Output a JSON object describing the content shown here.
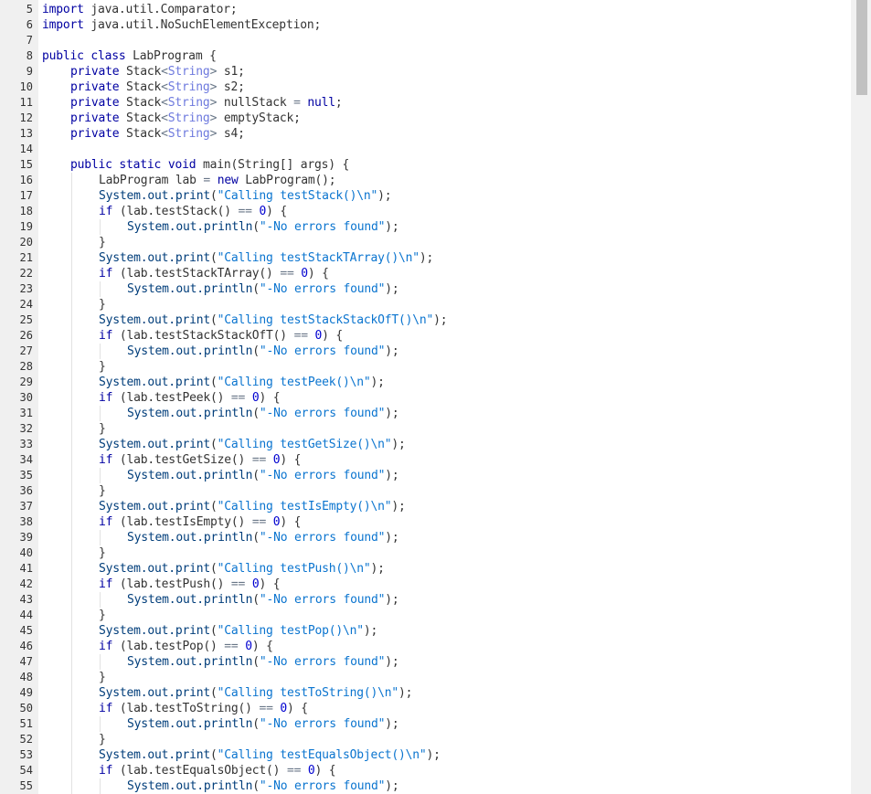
{
  "editor": {
    "lines": [
      {
        "n": "5",
        "indent": 0,
        "tokens": [
          [
            "k",
            "import"
          ],
          [
            "p",
            " java.util.Comparator;"
          ]
        ]
      },
      {
        "n": "6",
        "indent": 0,
        "tokens": [
          [
            "k",
            "import"
          ],
          [
            "p",
            " java.util.NoSuchElementException;"
          ]
        ]
      },
      {
        "n": "7",
        "indent": 0,
        "tokens": []
      },
      {
        "n": "8",
        "indent": 0,
        "tokens": [
          [
            "k",
            "public"
          ],
          [
            "p",
            " "
          ],
          [
            "k",
            "class"
          ],
          [
            "p",
            " LabProgram {"
          ]
        ]
      },
      {
        "n": "9",
        "indent": 1,
        "tokens": [
          [
            "k",
            "private"
          ],
          [
            "p",
            " Stack"
          ],
          [
            "o",
            "<"
          ],
          [
            "t",
            "String"
          ],
          [
            "o",
            ">"
          ],
          [
            "p",
            " s1;"
          ]
        ]
      },
      {
        "n": "10",
        "indent": 1,
        "tokens": [
          [
            "k",
            "private"
          ],
          [
            "p",
            " Stack"
          ],
          [
            "o",
            "<"
          ],
          [
            "t",
            "String"
          ],
          [
            "o",
            ">"
          ],
          [
            "p",
            " s2;"
          ]
        ]
      },
      {
        "n": "11",
        "indent": 1,
        "tokens": [
          [
            "k",
            "private"
          ],
          [
            "p",
            " Stack"
          ],
          [
            "o",
            "<"
          ],
          [
            "t",
            "String"
          ],
          [
            "o",
            ">"
          ],
          [
            "p",
            " nullStack "
          ],
          [
            "o",
            "="
          ],
          [
            "p",
            " "
          ],
          [
            "k",
            "null"
          ],
          [
            "p",
            ";"
          ]
        ]
      },
      {
        "n": "12",
        "indent": 1,
        "tokens": [
          [
            "k",
            "private"
          ],
          [
            "p",
            " Stack"
          ],
          [
            "o",
            "<"
          ],
          [
            "t",
            "String"
          ],
          [
            "o",
            ">"
          ],
          [
            "p",
            " emptyStack;"
          ]
        ]
      },
      {
        "n": "13",
        "indent": 1,
        "tokens": [
          [
            "k",
            "private"
          ],
          [
            "p",
            " Stack"
          ],
          [
            "o",
            "<"
          ],
          [
            "t",
            "String"
          ],
          [
            "o",
            ">"
          ],
          [
            "p",
            " s4;"
          ]
        ]
      },
      {
        "n": "14",
        "indent": 0,
        "tokens": []
      },
      {
        "n": "15",
        "indent": 1,
        "tokens": [
          [
            "k",
            "public"
          ],
          [
            "p",
            " "
          ],
          [
            "k",
            "static"
          ],
          [
            "p",
            " "
          ],
          [
            "k",
            "void"
          ],
          [
            "p",
            " main(String[] args) {"
          ]
        ]
      },
      {
        "n": "16",
        "indent": 2,
        "tokens": [
          [
            "p",
            "LabProgram lab "
          ],
          [
            "o",
            "="
          ],
          [
            "p",
            " "
          ],
          [
            "k",
            "new"
          ],
          [
            "p",
            " LabProgram();"
          ]
        ]
      },
      {
        "n": "17",
        "indent": 2,
        "tokens": [
          [
            "c",
            "System.out.print"
          ],
          [
            "p",
            "("
          ],
          [
            "s",
            "\"Calling testStack()\\n\""
          ],
          [
            "p",
            ");"
          ]
        ]
      },
      {
        "n": "18",
        "indent": 2,
        "tokens": [
          [
            "k",
            "if"
          ],
          [
            "p",
            " (lab.testStack() "
          ],
          [
            "o",
            "=="
          ],
          [
            "p",
            " "
          ],
          [
            "n",
            "0"
          ],
          [
            "p",
            ") {"
          ]
        ]
      },
      {
        "n": "19",
        "indent": 3,
        "tokens": [
          [
            "c",
            "System.out.println"
          ],
          [
            "p",
            "("
          ],
          [
            "s",
            "\"-No errors found\""
          ],
          [
            "p",
            ");"
          ]
        ]
      },
      {
        "n": "20",
        "indent": 2,
        "tokens": [
          [
            "p",
            "}"
          ]
        ]
      },
      {
        "n": "21",
        "indent": 2,
        "tokens": [
          [
            "c",
            "System.out.print"
          ],
          [
            "p",
            "("
          ],
          [
            "s",
            "\"Calling testStackTArray()\\n\""
          ],
          [
            "p",
            ");"
          ]
        ]
      },
      {
        "n": "22",
        "indent": 2,
        "tokens": [
          [
            "k",
            "if"
          ],
          [
            "p",
            " (lab.testStackTArray() "
          ],
          [
            "o",
            "=="
          ],
          [
            "p",
            " "
          ],
          [
            "n",
            "0"
          ],
          [
            "p",
            ") {"
          ]
        ]
      },
      {
        "n": "23",
        "indent": 3,
        "tokens": [
          [
            "c",
            "System.out.println"
          ],
          [
            "p",
            "("
          ],
          [
            "s",
            "\"-No errors found\""
          ],
          [
            "p",
            ");"
          ]
        ]
      },
      {
        "n": "24",
        "indent": 2,
        "tokens": [
          [
            "p",
            "}"
          ]
        ]
      },
      {
        "n": "25",
        "indent": 2,
        "tokens": [
          [
            "c",
            "System.out.print"
          ],
          [
            "p",
            "("
          ],
          [
            "s",
            "\"Calling testStackStackOfT()\\n\""
          ],
          [
            "p",
            ");"
          ]
        ]
      },
      {
        "n": "26",
        "indent": 2,
        "tokens": [
          [
            "k",
            "if"
          ],
          [
            "p",
            " (lab.testStackStackOfT() "
          ],
          [
            "o",
            "=="
          ],
          [
            "p",
            " "
          ],
          [
            "n",
            "0"
          ],
          [
            "p",
            ") {"
          ]
        ]
      },
      {
        "n": "27",
        "indent": 3,
        "tokens": [
          [
            "c",
            "System.out.println"
          ],
          [
            "p",
            "("
          ],
          [
            "s",
            "\"-No errors found\""
          ],
          [
            "p",
            ");"
          ]
        ]
      },
      {
        "n": "28",
        "indent": 2,
        "tokens": [
          [
            "p",
            "}"
          ]
        ]
      },
      {
        "n": "29",
        "indent": 2,
        "tokens": [
          [
            "c",
            "System.out.print"
          ],
          [
            "p",
            "("
          ],
          [
            "s",
            "\"Calling testPeek()\\n\""
          ],
          [
            "p",
            ");"
          ]
        ]
      },
      {
        "n": "30",
        "indent": 2,
        "tokens": [
          [
            "k",
            "if"
          ],
          [
            "p",
            " (lab.testPeek() "
          ],
          [
            "o",
            "=="
          ],
          [
            "p",
            " "
          ],
          [
            "n",
            "0"
          ],
          [
            "p",
            ") {"
          ]
        ]
      },
      {
        "n": "31",
        "indent": 3,
        "tokens": [
          [
            "c",
            "System.out.println"
          ],
          [
            "p",
            "("
          ],
          [
            "s",
            "\"-No errors found\""
          ],
          [
            "p",
            ");"
          ]
        ]
      },
      {
        "n": "32",
        "indent": 2,
        "tokens": [
          [
            "p",
            "}"
          ]
        ]
      },
      {
        "n": "33",
        "indent": 2,
        "tokens": [
          [
            "c",
            "System.out.print"
          ],
          [
            "p",
            "("
          ],
          [
            "s",
            "\"Calling testGetSize()\\n\""
          ],
          [
            "p",
            ");"
          ]
        ]
      },
      {
        "n": "34",
        "indent": 2,
        "tokens": [
          [
            "k",
            "if"
          ],
          [
            "p",
            " (lab.testGetSize() "
          ],
          [
            "o",
            "=="
          ],
          [
            "p",
            " "
          ],
          [
            "n",
            "0"
          ],
          [
            "p",
            ") {"
          ]
        ]
      },
      {
        "n": "35",
        "indent": 3,
        "tokens": [
          [
            "c",
            "System.out.println"
          ],
          [
            "p",
            "("
          ],
          [
            "s",
            "\"-No errors found\""
          ],
          [
            "p",
            ");"
          ]
        ]
      },
      {
        "n": "36",
        "indent": 2,
        "tokens": [
          [
            "p",
            "}"
          ]
        ]
      },
      {
        "n": "37",
        "indent": 2,
        "tokens": [
          [
            "c",
            "System.out.print"
          ],
          [
            "p",
            "("
          ],
          [
            "s",
            "\"Calling testIsEmpty()\\n\""
          ],
          [
            "p",
            ");"
          ]
        ]
      },
      {
        "n": "38",
        "indent": 2,
        "tokens": [
          [
            "k",
            "if"
          ],
          [
            "p",
            " (lab.testIsEmpty() "
          ],
          [
            "o",
            "=="
          ],
          [
            "p",
            " "
          ],
          [
            "n",
            "0"
          ],
          [
            "p",
            ") {"
          ]
        ]
      },
      {
        "n": "39",
        "indent": 3,
        "tokens": [
          [
            "c",
            "System.out.println"
          ],
          [
            "p",
            "("
          ],
          [
            "s",
            "\"-No errors found\""
          ],
          [
            "p",
            ");"
          ]
        ]
      },
      {
        "n": "40",
        "indent": 2,
        "tokens": [
          [
            "p",
            "}"
          ]
        ]
      },
      {
        "n": "41",
        "indent": 2,
        "tokens": [
          [
            "c",
            "System.out.print"
          ],
          [
            "p",
            "("
          ],
          [
            "s",
            "\"Calling testPush()\\n\""
          ],
          [
            "p",
            ");"
          ]
        ]
      },
      {
        "n": "42",
        "indent": 2,
        "tokens": [
          [
            "k",
            "if"
          ],
          [
            "p",
            " (lab.testPush() "
          ],
          [
            "o",
            "=="
          ],
          [
            "p",
            " "
          ],
          [
            "n",
            "0"
          ],
          [
            "p",
            ") {"
          ]
        ]
      },
      {
        "n": "43",
        "indent": 3,
        "tokens": [
          [
            "c",
            "System.out.println"
          ],
          [
            "p",
            "("
          ],
          [
            "s",
            "\"-No errors found\""
          ],
          [
            "p",
            ");"
          ]
        ]
      },
      {
        "n": "44",
        "indent": 2,
        "tokens": [
          [
            "p",
            "}"
          ]
        ]
      },
      {
        "n": "45",
        "indent": 2,
        "tokens": [
          [
            "c",
            "System.out.print"
          ],
          [
            "p",
            "("
          ],
          [
            "s",
            "\"Calling testPop()\\n\""
          ],
          [
            "p",
            ");"
          ]
        ]
      },
      {
        "n": "46",
        "indent": 2,
        "tokens": [
          [
            "k",
            "if"
          ],
          [
            "p",
            " (lab.testPop() "
          ],
          [
            "o",
            "=="
          ],
          [
            "p",
            " "
          ],
          [
            "n",
            "0"
          ],
          [
            "p",
            ") {"
          ]
        ]
      },
      {
        "n": "47",
        "indent": 3,
        "tokens": [
          [
            "c",
            "System.out.println"
          ],
          [
            "p",
            "("
          ],
          [
            "s",
            "\"-No errors found\""
          ],
          [
            "p",
            ");"
          ]
        ]
      },
      {
        "n": "48",
        "indent": 2,
        "tokens": [
          [
            "p",
            "}"
          ]
        ]
      },
      {
        "n": "49",
        "indent": 2,
        "tokens": [
          [
            "c",
            "System.out.print"
          ],
          [
            "p",
            "("
          ],
          [
            "s",
            "\"Calling testToString()\\n\""
          ],
          [
            "p",
            ");"
          ]
        ]
      },
      {
        "n": "50",
        "indent": 2,
        "tokens": [
          [
            "k",
            "if"
          ],
          [
            "p",
            " (lab.testToString() "
          ],
          [
            "o",
            "=="
          ],
          [
            "p",
            " "
          ],
          [
            "n",
            "0"
          ],
          [
            "p",
            ") {"
          ]
        ]
      },
      {
        "n": "51",
        "indent": 3,
        "tokens": [
          [
            "c",
            "System.out.println"
          ],
          [
            "p",
            "("
          ],
          [
            "s",
            "\"-No errors found\""
          ],
          [
            "p",
            ");"
          ]
        ]
      },
      {
        "n": "52",
        "indent": 2,
        "tokens": [
          [
            "p",
            "}"
          ]
        ]
      },
      {
        "n": "53",
        "indent": 2,
        "tokens": [
          [
            "c",
            "System.out.print"
          ],
          [
            "p",
            "("
          ],
          [
            "s",
            "\"Calling testEqualsObject()\\n\""
          ],
          [
            "p",
            ");"
          ]
        ]
      },
      {
        "n": "54",
        "indent": 2,
        "tokens": [
          [
            "k",
            "if"
          ],
          [
            "p",
            " (lab.testEqualsObject() "
          ],
          [
            "o",
            "=="
          ],
          [
            "p",
            " "
          ],
          [
            "n",
            "0"
          ],
          [
            "p",
            ") {"
          ]
        ]
      },
      {
        "n": "55",
        "indent": 3,
        "tokens": [
          [
            "c",
            "System.out.println"
          ],
          [
            "p",
            "("
          ],
          [
            "s",
            "\"-No errors found\""
          ],
          [
            "p",
            ");"
          ]
        ]
      }
    ]
  },
  "colors": {
    "keyword": "#0000a2",
    "type": "#6d79de",
    "string": "#0a74cf",
    "call": "#003d7a",
    "operator": "#687687",
    "number": "#0000d0",
    "plain": "#333333",
    "gutter_bg": "#f0f0f0",
    "scrollbar_thumb": "#c1c1c1"
  }
}
